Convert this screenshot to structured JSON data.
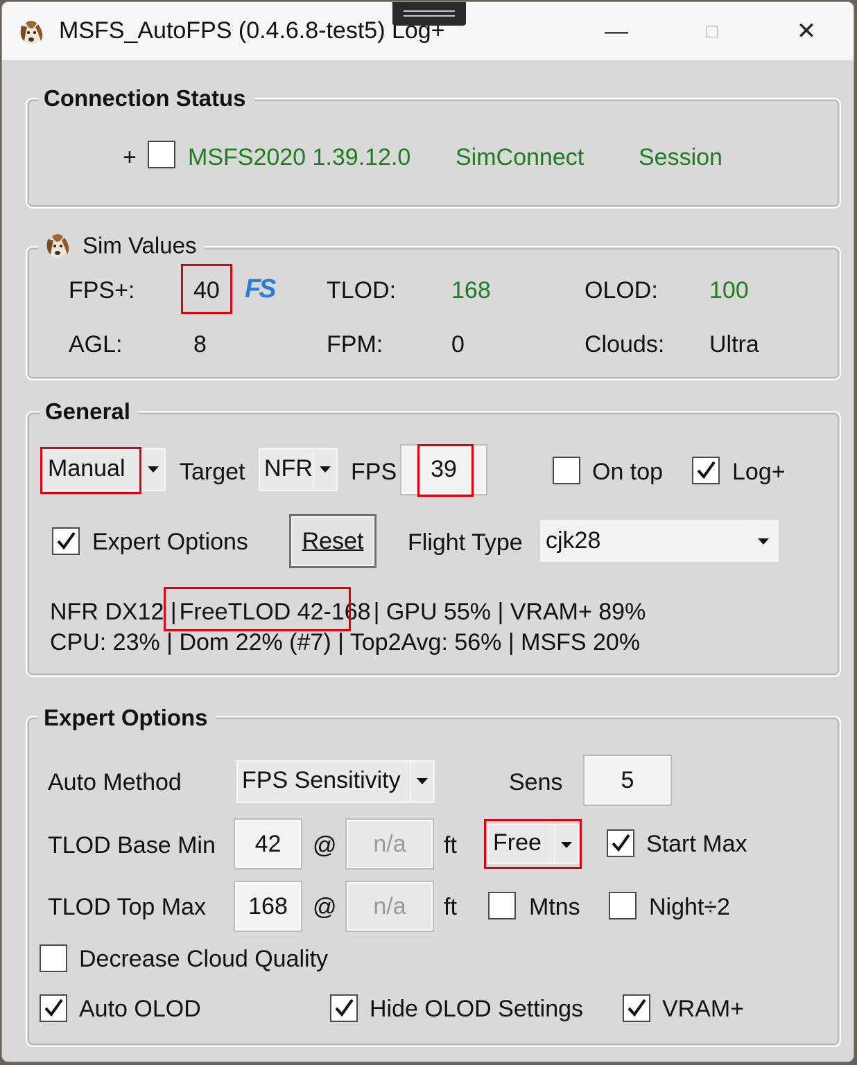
{
  "window": {
    "title": "MSFS_AutoFPS (0.4.6.8-test5) Log+",
    "minimize": "—",
    "maximize": "□",
    "close": "✕"
  },
  "connection": {
    "group_title": "Connection Status",
    "plus": "+",
    "checkbox_checked": false,
    "sim_version": "MSFS2020 1.39.12.0",
    "simconnect": "SimConnect",
    "session": "Session"
  },
  "sim_values": {
    "group_title": "Sim Values",
    "fps_label": "FPS+:",
    "fps_value": "40",
    "fs_logo": "FS",
    "tlod_label": "TLOD:",
    "tlod_value": "168",
    "olod_label": "OLOD:",
    "olod_value": "100",
    "agl_label": "AGL:",
    "agl_value": "8",
    "fpm_label": "FPM:",
    "fpm_value": "0",
    "clouds_label": "Clouds:",
    "clouds_value": "Ultra"
  },
  "general": {
    "group_title": "General",
    "mode_select": "Manual",
    "target_label": "Target",
    "target_select": "NFR",
    "fps_label": "FPS",
    "fps_value": "39",
    "ontop_label": "On top",
    "ontop_checked": false,
    "logplus_label": "Log+",
    "logplus_checked": true,
    "expert_label": "Expert Options",
    "expert_checked": true,
    "reset_label": "Reset",
    "flight_type_label": "Flight Type",
    "flight_type_select": "cjk28",
    "status_line1_a": "NFR DX12 |",
    "status_line1_b": "FreeTLOD 42-168",
    "status_line1_c": "| GPU 55% | VRAM+ 89%",
    "status_line2": "CPU: 23% | Dom 22% (#7) | Top2Avg: 56% | MSFS 20%"
  },
  "expert": {
    "group_title": "Expert Options",
    "auto_method_label": "Auto Method",
    "auto_method_select": "FPS Sensitivity",
    "sens_label": "Sens",
    "sens_value": "5",
    "base_min_label": "TLOD Base Min",
    "base_min_value": "42",
    "at": "@",
    "alt_placeholder": "n/a",
    "ft": "ft",
    "free_select": "Free",
    "start_max_label": "Start Max",
    "start_max_checked": true,
    "top_max_label": "TLOD Top Max",
    "top_max_value": "168",
    "mtns_label": "Mtns",
    "mtns_checked": false,
    "night_label": "Night÷2",
    "night_checked": false,
    "decrease_cloud_label": "Decrease Cloud Quality",
    "decrease_cloud_checked": false,
    "auto_olod_label": "Auto OLOD",
    "auto_olod_checked": true,
    "hide_olod_label": "Hide OLOD Settings",
    "hide_olod_checked": true,
    "vram_label": "VRAM+",
    "vram_checked": true
  },
  "colors": {
    "accent_green": "#1e7d1e",
    "highlight_red": "#e0000c",
    "fs_logo_blue": "#2a7fd4"
  },
  "icons": [
    "dog-app-icon",
    "fs-logo-icon",
    "dropdown-arrow-icon",
    "check-icon"
  ]
}
